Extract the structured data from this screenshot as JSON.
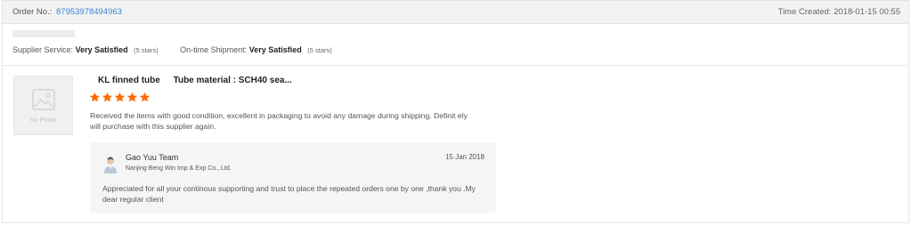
{
  "header": {
    "order_label": "Order No.:",
    "order_number": "87953978494963",
    "time_created_label": "Time Created:",
    "time_created_value": "2018-01-15 00:55"
  },
  "ratings": {
    "supplier_service_label": "Supplier Service:",
    "supplier_service_value": "Very Satisfied",
    "supplier_service_stars": "(5 stars)",
    "shipment_label": "On-time Shipment:",
    "shipment_value": "Very Satisfied",
    "shipment_stars": "(5 stars)"
  },
  "product": {
    "photo_placeholder": "No Photo",
    "name": "KL finned tube",
    "spec": "Tube material : SCH40 sea...",
    "rating": 5,
    "star_color": "#ff6a00",
    "review": "Received the items with good condition, excellent in packaging to avoid any damage during shipping. Definit ely will purchase with this supplier again."
  },
  "reply": {
    "author": "Gao Yuu Team",
    "company": "Nanjing Beng Win Imp & Exp Co., Ltd.",
    "date": "15 Jan 2018",
    "text": "Appreciated for all your continous supporting and trust to place the repeated orders one by one ,thank you .My dear regular client"
  },
  "colors": {
    "link": "#3a84d6",
    "header_bg": "#f3f3f3"
  }
}
